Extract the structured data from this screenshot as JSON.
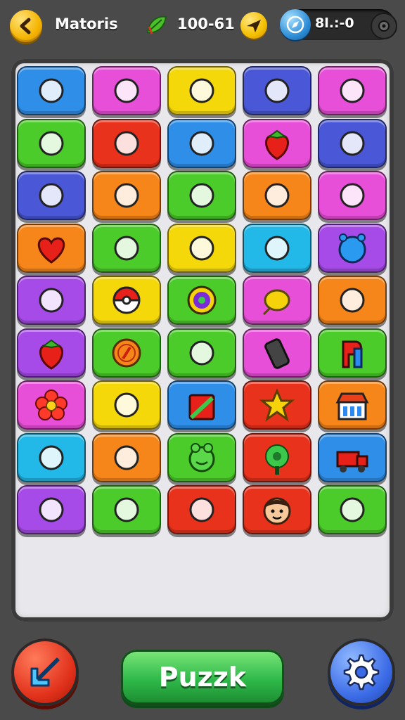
{
  "header": {
    "title": "Matoris",
    "score": "100-61",
    "counter": "8l.:-0"
  },
  "buttons": {
    "play_label": "Puzzk"
  },
  "colors": {
    "blue": "#2f8fe8",
    "pink": "#e84fd8",
    "yellow": "#f5d80a",
    "navy": "#4a58d8",
    "green": "#4ccc2a",
    "red": "#e8321c",
    "orange": "#f7861a",
    "purple": "#a64ae8",
    "cyan": "#22b8e8"
  },
  "grid": [
    [
      {
        "c": "blue",
        "i": "bread-icon"
      },
      {
        "c": "pink",
        "i": "meat-icon"
      },
      {
        "c": "yellow",
        "i": "carrot-icon"
      },
      {
        "c": "navy",
        "i": "card-icon"
      },
      {
        "c": "pink",
        "i": "drum-icon"
      }
    ],
    [
      {
        "c": "green",
        "i": "pinecone-icon"
      },
      {
        "c": "red",
        "i": "leaf-icon"
      },
      {
        "c": "blue",
        "i": "radish-icon"
      },
      {
        "c": "pink",
        "i": "strawberry-icon"
      },
      {
        "c": "navy",
        "i": "pickaxe-icon"
      }
    ],
    [
      {
        "c": "navy",
        "i": "shell-icon"
      },
      {
        "c": "orange",
        "i": "chick-icon"
      },
      {
        "c": "green",
        "i": "battery-icon"
      },
      {
        "c": "orange",
        "i": "cucumber-icon"
      },
      {
        "c": "pink",
        "i": "paint-tube-icon"
      }
    ],
    [
      {
        "c": "orange",
        "i": "heart-icon"
      },
      {
        "c": "green",
        "i": "paintbrush-icon"
      },
      {
        "c": "yellow",
        "i": "mushroom-icon"
      },
      {
        "c": "cyan",
        "i": "orange-fruit-icon"
      },
      {
        "c": "purple",
        "i": "bear-ball-icon"
      }
    ],
    [
      {
        "c": "purple",
        "i": "crayon-icon"
      },
      {
        "c": "yellow",
        "i": "pokeball-icon"
      },
      {
        "c": "green",
        "i": "donut-icon"
      },
      {
        "c": "pink",
        "i": "lemon-icon"
      },
      {
        "c": "orange",
        "i": "bird-icon"
      }
    ],
    [
      {
        "c": "purple",
        "i": "strawberry-icon"
      },
      {
        "c": "green",
        "i": "coin-icon"
      },
      {
        "c": "green",
        "i": "corn-icon"
      },
      {
        "c": "pink",
        "i": "phone-icon"
      },
      {
        "c": "green",
        "i": "letter-p-icon"
      }
    ],
    [
      {
        "c": "pink",
        "i": "flower-icon"
      },
      {
        "c": "yellow",
        "i": "rocket-icon"
      },
      {
        "c": "blue",
        "i": "box-icon"
      },
      {
        "c": "red",
        "i": "star-face-icon"
      },
      {
        "c": "orange",
        "i": "shop-icon"
      }
    ],
    [
      {
        "c": "cyan",
        "i": "lemon-drop-icon"
      },
      {
        "c": "orange",
        "i": "stopwatch-icon"
      },
      {
        "c": "green",
        "i": "frog-icon"
      },
      {
        "c": "red",
        "i": "gear-flower-icon"
      },
      {
        "c": "blue",
        "i": "truck-icon"
      }
    ],
    [
      {
        "c": "purple",
        "i": "spinning-top-icon"
      },
      {
        "c": "green",
        "i": "lamp-icon"
      },
      {
        "c": "red",
        "i": "bulb-icon"
      },
      {
        "c": "red",
        "i": "face-icon"
      },
      {
        "c": "green",
        "i": "jar-icon"
      }
    ]
  ]
}
